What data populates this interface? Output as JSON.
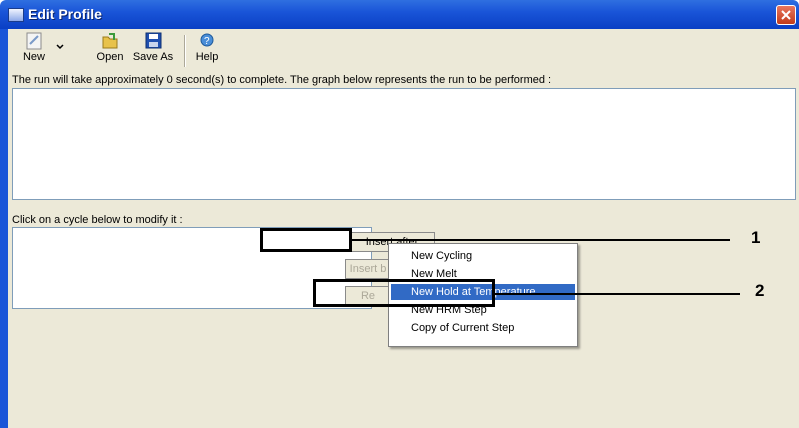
{
  "window": {
    "title": "Edit Profile"
  },
  "toolbar": {
    "new_label": "New",
    "open_label": "Open",
    "saveas_label": "Save As",
    "help_label": "Help"
  },
  "info_text": "The run will take approximately 0 second(s) to complete. The graph below represents the run to be performed :",
  "cycle_prompt": "Click on a cycle below to modify it :",
  "buttons": {
    "insert_after": "Insert after",
    "insert_before": "Insert b",
    "remove": "Re"
  },
  "context_menu": {
    "items": [
      "New Cycling",
      "New Melt",
      "New Hold at Temperature",
      "New HRM Step",
      "Copy of Current Step"
    ],
    "selected_index": 2
  },
  "callouts": {
    "one": "1",
    "two": "2"
  },
  "colors": {
    "title_bar": "#1a55d8",
    "selection": "#316ac5",
    "face": "#ece9d8"
  }
}
